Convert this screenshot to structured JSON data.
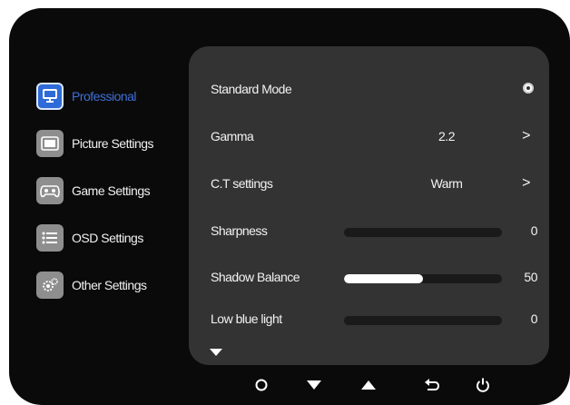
{
  "sidebar": {
    "items": [
      {
        "label": "Professional",
        "icon": "monitor-icon",
        "active": true
      },
      {
        "label": "Picture Settings",
        "icon": "picture-frame-icon",
        "active": false
      },
      {
        "label": "Game Settings",
        "icon": "gamepad-icon",
        "active": false
      },
      {
        "label": "OSD Settings",
        "icon": "list-icon",
        "active": false
      },
      {
        "label": "Other Settings",
        "icon": "gears-icon",
        "active": false
      }
    ]
  },
  "panel": {
    "standard_mode": {
      "label": "Standard Mode",
      "selected": true
    },
    "gamma": {
      "label": "Gamma",
      "value": "2.2"
    },
    "ct": {
      "label": "C.T settings",
      "value": "Warm"
    },
    "sharpness": {
      "label": "Sharpness",
      "value": "0",
      "level": 0
    },
    "shadow_balance": {
      "label": "Shadow Balance",
      "value": "50",
      "level": 0.5
    },
    "low_blue": {
      "label": "Low blue light",
      "value": "0",
      "level": 0
    }
  },
  "buttons": [
    {
      "icon": "circle-icon"
    },
    {
      "icon": "down-arrow-icon"
    },
    {
      "icon": "up-arrow-icon"
    },
    {
      "icon": "return-icon"
    },
    {
      "icon": "power-icon"
    }
  ],
  "colors": {
    "frame": "#0a0a0a",
    "panel": "#333333",
    "accent": "#3f6fd6"
  }
}
